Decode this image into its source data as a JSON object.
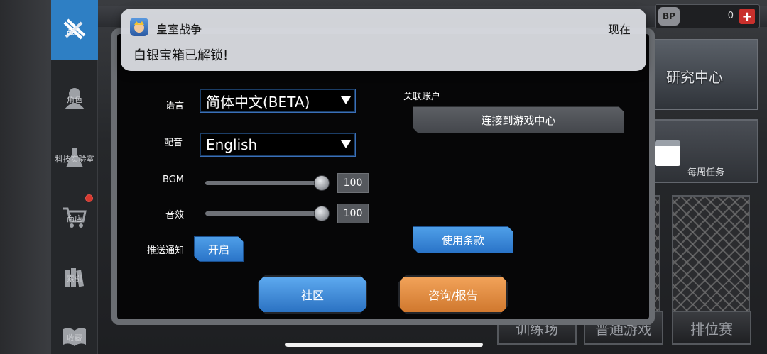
{
  "notification": {
    "app_name": "皇室战争",
    "time": "现在",
    "message": "白银宝箱已解锁!"
  },
  "sidebar": {
    "items": [
      {
        "label": "战斗",
        "icon": "crossed-guns-icon",
        "active": true
      },
      {
        "label": "角色",
        "icon": "character-icon"
      },
      {
        "label": "科技实验室",
        "icon": "flask-icon"
      },
      {
        "label": "商店",
        "icon": "cart-icon",
        "has_badge": true
      },
      {
        "label": "索引",
        "icon": "books-icon"
      },
      {
        "label": "收藏",
        "icon": "open-book-icon"
      }
    ]
  },
  "top_bar": {
    "currency_icon": "BP",
    "currency_value": "0"
  },
  "background_panels": {
    "research_center": "研究中心",
    "weekly_tasks": "每周任务",
    "modes": [
      "训练场",
      "普通游戏",
      "排位赛"
    ]
  },
  "settings": {
    "language_label": "语言",
    "language_value": "简体中文(BETA)",
    "voice_label": "配音",
    "voice_value": "English",
    "bgm_label": "BGM",
    "bgm_value": "100",
    "sfx_label": "音效",
    "sfx_value": "100",
    "push_label": "推送通知",
    "push_button": "开启",
    "linked_account_label": "关联账户",
    "connect_game_center": "连接到游戏中心",
    "terms_button": "使用条款",
    "community_button": "社区",
    "support_button": "咨询/报告"
  },
  "colors": {
    "accent_blue": "#2e7fc4",
    "orange": "#e08c40",
    "dialog_bg": "#060607"
  }
}
